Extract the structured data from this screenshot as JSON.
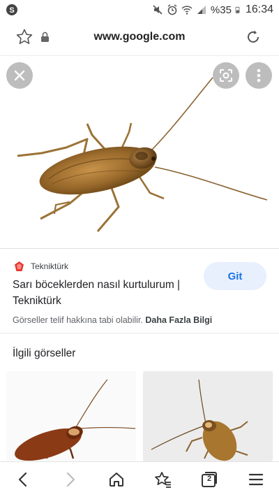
{
  "status_bar": {
    "battery_percent": "%35",
    "time": "16:34",
    "icons": [
      "skype-icon",
      "mute-icon",
      "alarm-icon",
      "wifi-icon",
      "signal-icon",
      "battery-icon"
    ]
  },
  "url_bar": {
    "url": "www.google.com",
    "icons": [
      "star-icon",
      "lock-icon",
      "reload-icon"
    ]
  },
  "viewer": {
    "image_subject": "cockroach",
    "buttons": [
      "close-icon",
      "lens-icon",
      "more-icon"
    ]
  },
  "result": {
    "source_name": "Tekniktürk",
    "title": "Sarı böceklerden nasıl kurtulurum | Tekniktürk",
    "go_label": "Git",
    "copyright_text": "Görseller telif hakkına tabi olabilir.",
    "more_info_label": "Daha Fazla Bilgi"
  },
  "related": {
    "title": "İlgili görseller"
  },
  "bottom_nav": {
    "tab_count": "2",
    "icons": [
      "back-icon",
      "forward-icon",
      "home-icon",
      "bookmarks-icon",
      "tabs-icon",
      "menu-icon"
    ]
  },
  "colors": {
    "accent": "#1a73e8",
    "button_bg": "#e8f0fe",
    "overlay_button": "#bdbdbd"
  }
}
